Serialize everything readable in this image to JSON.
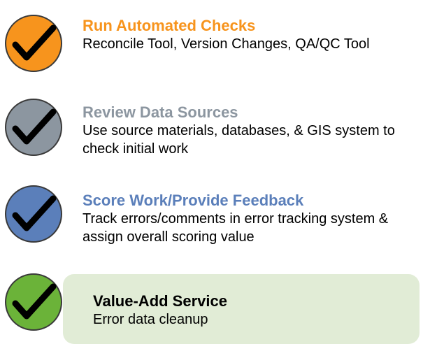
{
  "steps": [
    {
      "title": "Run Automated Checks",
      "description": "Reconcile Tool, Version Changes, QA/QC Tool",
      "badge_color": "#f7941d",
      "title_color": "#f7941d"
    },
    {
      "title": "Review Data Sources",
      "description": "Use source materials, databases, & GIS system to check initial work",
      "badge_color": "#8c96a0",
      "title_color": "#8c96a0"
    },
    {
      "title": "Score Work/Provide Feedback",
      "description": "Track errors/comments in error tracking system & assign overall scoring value",
      "badge_color": "#5b7fba",
      "title_color": "#5b7fba"
    },
    {
      "title": "Value-Add Service",
      "description": "Error data cleanup",
      "badge_color": "#6bb339",
      "title_color": "#000000",
      "panel_color": "#e1ecd6"
    }
  ],
  "icons": {
    "badge": "checkmark-circle-icon"
  }
}
